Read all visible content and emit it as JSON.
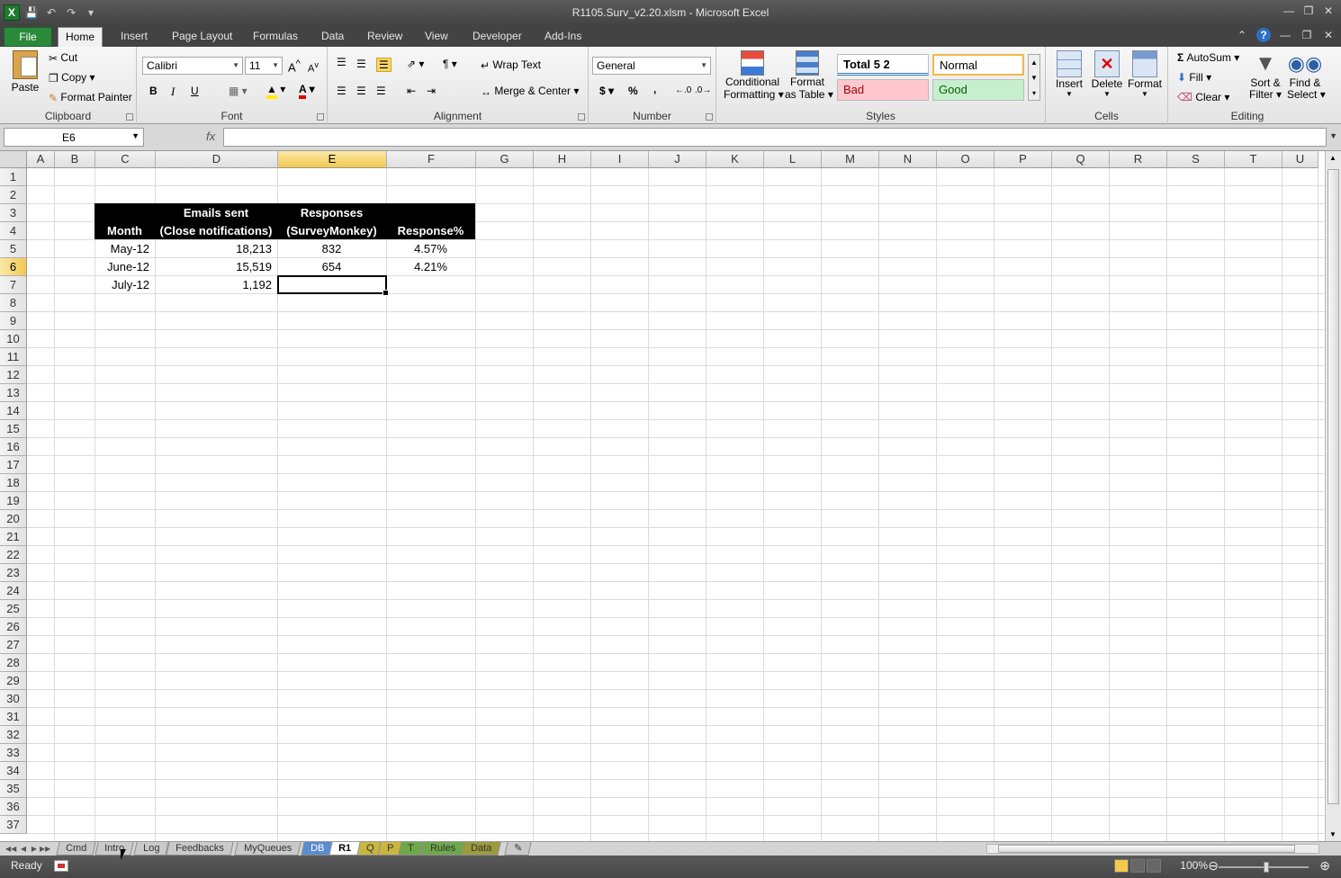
{
  "window": {
    "title": "R1105.Surv_v2.20.xlsm  -  Microsoft Excel",
    "logo": "X"
  },
  "ribbon_tabs": [
    "File",
    "Home",
    "Insert",
    "Page Layout",
    "Formulas",
    "Data",
    "Review",
    "View",
    "Developer",
    "Add-Ins"
  ],
  "clipboard": {
    "label": "Clipboard",
    "paste": "Paste",
    "cut": "Cut",
    "copy": "Copy",
    "format_painter": "Format Painter"
  },
  "font": {
    "label": "Font",
    "family": "Calibri",
    "size": "11",
    "bold": "B",
    "italic": "I",
    "underline": "U",
    "color_glyph": "A"
  },
  "alignment": {
    "label": "Alignment",
    "wrap_text": "Wrap Text",
    "merge_center": "Merge & Center"
  },
  "number": {
    "label": "Number",
    "format": "General",
    "currency": "$",
    "percent": "%",
    "comma": ","
  },
  "styles": {
    "label": "Styles",
    "conditional": "Conditional",
    "conditional2": "Formatting",
    "format_table": "Format",
    "format_table2": "as Table",
    "total": "Total 5 2",
    "normal": "Normal",
    "bad": "Bad",
    "good": "Good"
  },
  "cells": {
    "label": "Cells",
    "insert": "Insert",
    "delete": "Delete",
    "format": "Format"
  },
  "editing": {
    "label": "Editing",
    "autosum": "AutoSum",
    "fill": "Fill",
    "clear": "Clear",
    "sort": "Sort &",
    "sort2": "Filter",
    "find": "Find &",
    "find2": "Select"
  },
  "formula_bar": {
    "name_box": "E6",
    "fx": "fx",
    "value": ""
  },
  "columns": [
    "A",
    "B",
    "C",
    "D",
    "E",
    "F",
    "G",
    "H",
    "I",
    "J",
    "K",
    "L",
    "M",
    "N",
    "O",
    "P",
    "Q",
    "R",
    "S",
    "T",
    "U"
  ],
  "rows": [
    "1",
    "2",
    "3",
    "4",
    "5",
    "6",
    "7",
    "8",
    "9",
    "10",
    "11",
    "12",
    "13",
    "14",
    "15",
    "16",
    "17",
    "18",
    "19",
    "20",
    "21",
    "22",
    "23",
    "24",
    "25",
    "26",
    "27",
    "28",
    "29",
    "30",
    "31",
    "32",
    "33",
    "34",
    "35",
    "36",
    "37"
  ],
  "table": {
    "header_top": {
      "emails": "Emails sent",
      "responses": "Responses"
    },
    "header_bottom": {
      "month": "Month",
      "emails": "(Close notifications)",
      "responses": "(SurveyMonkey)",
      "pct": "Response%"
    },
    "rows": [
      {
        "month": "May-12",
        "emails": "18,213",
        "responses": "832",
        "pct": "4.57%"
      },
      {
        "month": "June-12",
        "emails": "15,519",
        "responses": "654",
        "pct": "4.21%"
      },
      {
        "month": "July-12",
        "emails": "1,192",
        "responses": "",
        "pct": ""
      }
    ]
  },
  "sheet_tabs": [
    "Cmd",
    "Intro",
    "Log",
    "Feedbacks",
    "MyQueues",
    "DB",
    "R1",
    "Q",
    "P",
    "T",
    "Rules",
    "Data"
  ],
  "status": {
    "ready": "Ready",
    "zoom": "100%"
  }
}
